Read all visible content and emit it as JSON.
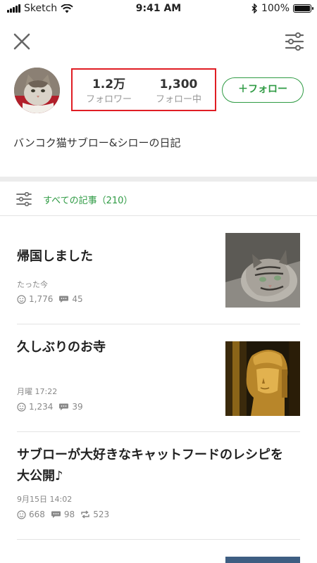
{
  "status_bar": {
    "carrier": "Sketch",
    "time": "9:41 AM",
    "battery_text": "100%",
    "battery_level": 1.0
  },
  "header": {
    "close_icon": "close-icon",
    "menu_icon": "sliders-icon"
  },
  "profile": {
    "followers_count": "1.2万",
    "followers_label": "フォロワー",
    "following_count": "1,300",
    "following_label": "フォロー中",
    "follow_button_label": "＋フォロー",
    "bio": "バンコク猫サブロー&シローの日記"
  },
  "filter": {
    "label": "すべての記事（210）"
  },
  "articles": [
    {
      "title": "帰国しました",
      "date": "たった今",
      "likes": "1,776",
      "comments": "45"
    },
    {
      "title": "久しぶりのお寺",
      "date": "月曜 17:22",
      "likes": "1,234",
      "comments": "39"
    },
    {
      "title_line1": "サブローが大好きなキャットフードのレシピを",
      "title_line2": "大公開♪",
      "date": "9月15日 14:02",
      "likes": "668",
      "comments": "98",
      "reposts": "523"
    }
  ],
  "colors": {
    "accent_green": "#2f9b44",
    "highlight_red": "#e01d24"
  }
}
